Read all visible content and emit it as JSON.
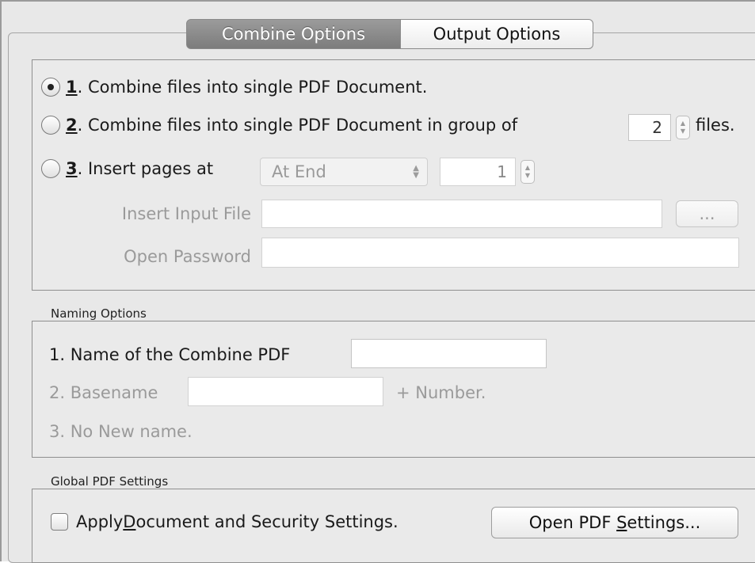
{
  "tabs": {
    "combine": "Combine Options",
    "output": "Output Options"
  },
  "combine": {
    "opt1": {
      "number": "1",
      "text": ". Combine files into single PDF Document.",
      "selected": true
    },
    "opt2": {
      "number": "2",
      "text": ". Combine files into single PDF Document in group of",
      "group_value": "2",
      "suffix": "files.",
      "selected": false
    },
    "opt3": {
      "number": "3",
      "text": ". Insert pages at",
      "position_value": "At End",
      "page_value": "1",
      "selected": false
    },
    "insert_input_file_label": "Insert Input File",
    "insert_input_file_value": "",
    "browse_label": "...",
    "open_password_label": "Open Password",
    "open_password_value": ""
  },
  "naming": {
    "title": "Naming Options",
    "opt1": "1. Name of the Combine PDF",
    "opt1_value": "",
    "opt2": "2. Basename",
    "opt2_value": "",
    "opt2_suffix": "+ Number.",
    "opt3": "3. No New name."
  },
  "global": {
    "title": "Global PDF Settings",
    "checkbox_pre": "Apply ",
    "checkbox_key": "D",
    "checkbox_post": "ocument and Security Settings.",
    "checked": false,
    "button_pre": "Open PDF ",
    "button_key": "S",
    "button_post": "ettings..."
  },
  "colors": {
    "active_tab": "#8a8a8a",
    "panel": "#e8e8e8",
    "disabled_text": "#9a9a9a"
  }
}
